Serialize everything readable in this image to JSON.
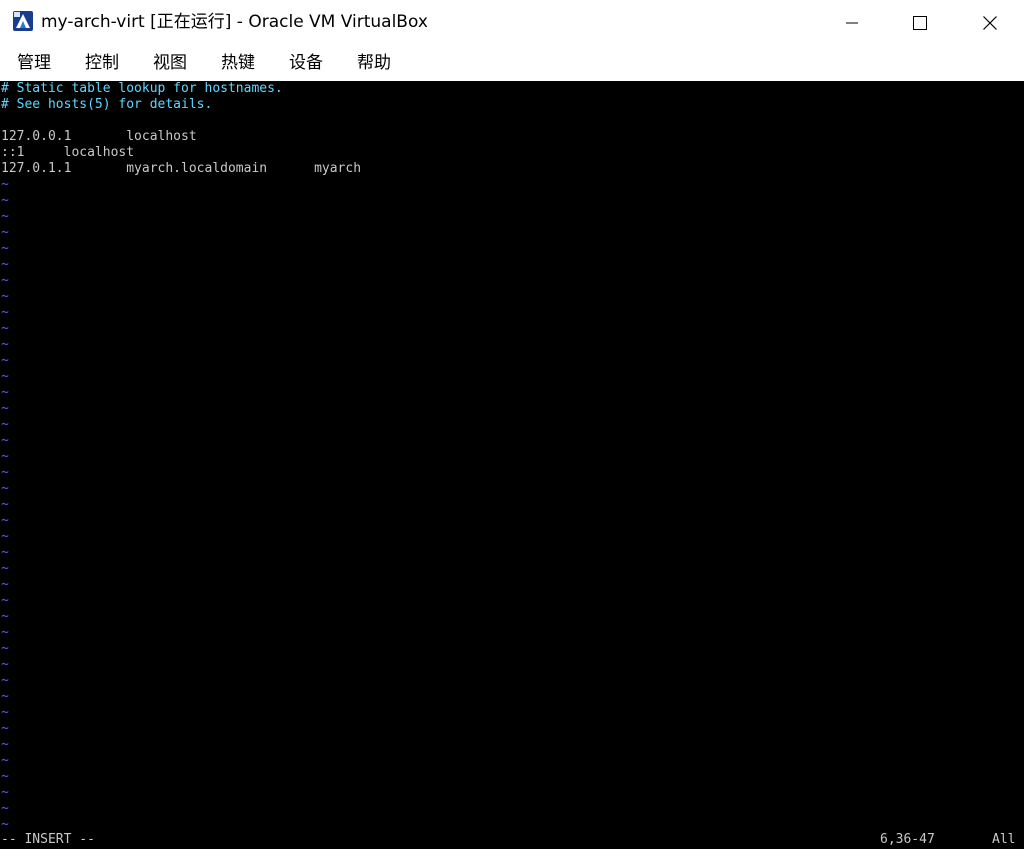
{
  "window": {
    "title": "my-arch-virt [正在运行] - Oracle VM VirtualBox",
    "icon": "virtualbox-icon"
  },
  "controls": {
    "minimize_icon": "minimize-icon",
    "maximize_icon": "maximize-icon",
    "close_icon": "close-icon"
  },
  "menu": {
    "items": [
      {
        "label": "管理"
      },
      {
        "label": "控制"
      },
      {
        "label": "视图"
      },
      {
        "label": "热键"
      },
      {
        "label": "设备"
      },
      {
        "label": "帮助"
      }
    ]
  },
  "terminal": {
    "lines": [
      {
        "text": "# Static table lookup for hostnames.",
        "kind": "comment"
      },
      {
        "text": "# See hosts(5) for details.",
        "kind": "comment"
      },
      {
        "text": "",
        "kind": "normal"
      },
      {
        "text": "127.0.0.1       localhost",
        "kind": "normal"
      },
      {
        "text": "::1     localhost",
        "kind": "normal"
      },
      {
        "text": "127.0.1.1       myarch.localdomain      myarch",
        "kind": "normal"
      }
    ],
    "tilde": "~",
    "tilde_count": 41,
    "status": {
      "mode": "-- INSERT --",
      "position": "6,36-47",
      "scroll": "All"
    },
    "colors": {
      "background": "#000000",
      "text": "#c8c8c8",
      "comment": "#5fd7ff",
      "tilde": "#5a5aff"
    }
  }
}
